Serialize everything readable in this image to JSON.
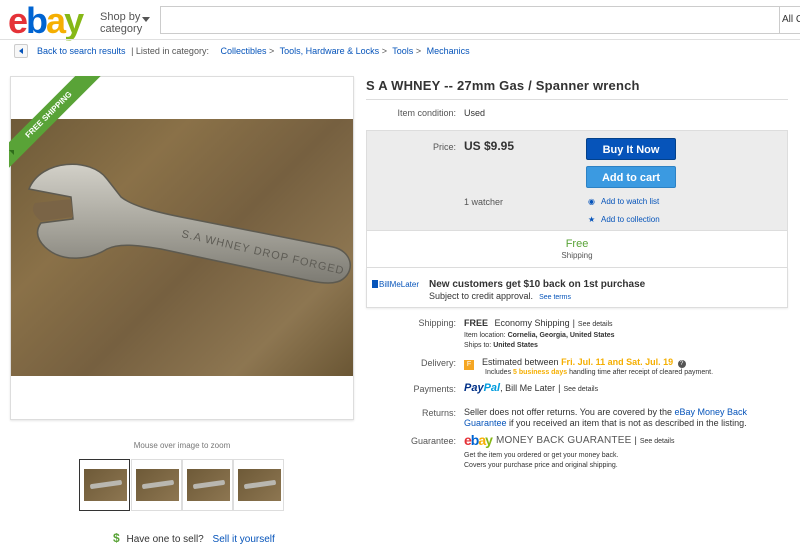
{
  "header": {
    "logo": {
      "e": "e",
      "b": "b",
      "a": "a",
      "y": "y"
    },
    "shop_by_category": "Shop by\ncategory",
    "search": {
      "value": "",
      "category": "All C"
    }
  },
  "breadcrumb": {
    "back_label": "Back to search results",
    "listed_in": "| Listed in category:",
    "items": [
      "Collectibles",
      ">",
      "Tools, Hardware & Locks",
      ">",
      "Tools",
      ">",
      "Mechanics"
    ]
  },
  "gallery": {
    "ribbon": "FREE SHIPPING",
    "mouseover": "Mouse over image to zoom",
    "photo_engraving": "S.A WHNEY DROP FORGED",
    "thumbnail_count": 4,
    "selected_thumbnail": 1
  },
  "sell": {
    "icon": "$",
    "question": "Have one to sell?",
    "link": "Sell it yourself"
  },
  "item": {
    "title": "S A WHNEY -- 27mm Gas / Spanner wrench",
    "condition_label": "Item condition:",
    "condition_value": "Used"
  },
  "buybox": {
    "price_label": "Price:",
    "price": "US $9.95",
    "buy_now": "Buy It Now",
    "add_to_cart": "Add to cart",
    "watchers": "1 watcher",
    "watch_list": "Add to watch list",
    "collection": "Add to collection",
    "free": "Free",
    "shipping": "Shipping"
  },
  "billmelater": {
    "logo": "BillMeLater",
    "headline": "New customers get $10 back on 1st purchase",
    "sub": "Subject to credit approval.",
    "see_terms": "See terms"
  },
  "details": {
    "shipping_label": "Shipping:",
    "shipping_free": "FREE",
    "shipping_method": "Economy Shipping",
    "see_details": "See details",
    "item_location_label": "Item location:",
    "item_location": "Cornelia, Georgia, United States",
    "ships_to_label": "Ships to:",
    "ships_to": "United States",
    "delivery_label": "Delivery:",
    "delivery_prefix": "Estimated between",
    "delivery_dates": "Fri. Jul. 11 and Sat. Jul. 19",
    "delivery_includes": "Includes",
    "business_days": "5 business days",
    "delivery_suffix": "handling time after receipt of cleared payment.",
    "payments_label": "Payments:",
    "paypal_1": "Pay",
    "paypal_2": "Pal",
    "bill_me_later": ", Bill Me Later",
    "payments_see_details": "See details",
    "returns_label": "Returns:",
    "returns_text": "Seller does not offer returns. You are covered by the",
    "returns_link_1": "eBay Money Back",
    "returns_link_2": "Guarantee",
    "returns_suffix": "if you received an item that is not as described in the listing.",
    "guarantee_label": "Guarantee:",
    "guarantee_name": "MONEY BACK GUARANTEE",
    "guarantee_see_details": "See details",
    "guarantee_line1": "Get the item you ordered or get your money back.",
    "guarantee_line2": "Covers your purchase price and original shipping."
  },
  "colors": {
    "ebay_red": "#e53238",
    "ebay_blue": "#0064d2",
    "ebay_yellow": "#f5af02",
    "ebay_green": "#86b817",
    "link": "#0654ba",
    "buy_now": "#0654ba",
    "add_to_cart": "#3b9ae1",
    "free_green": "#59a337"
  }
}
